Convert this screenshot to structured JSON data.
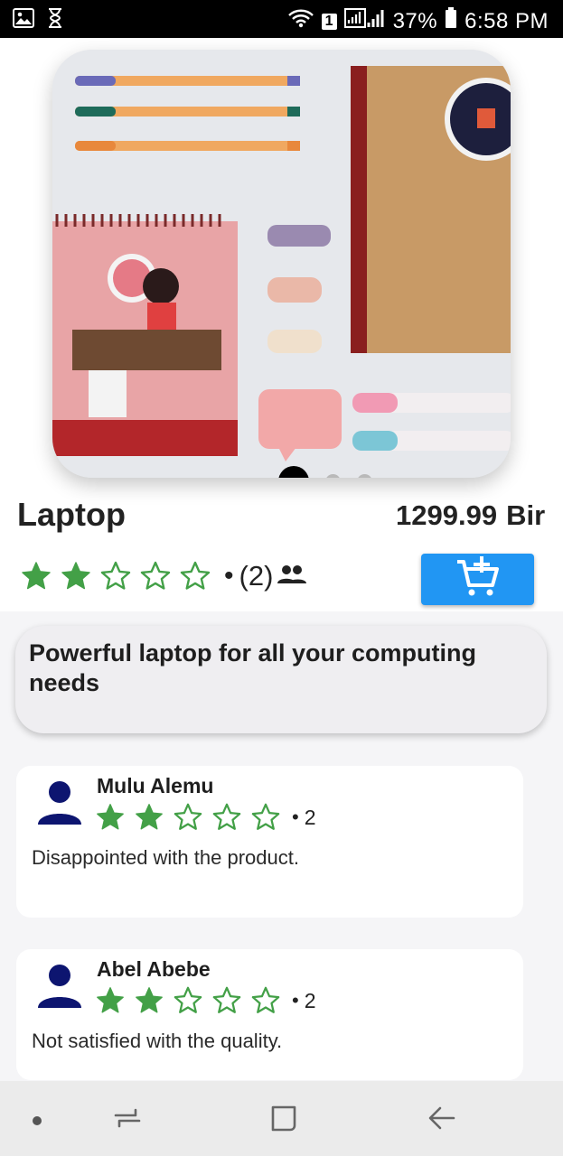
{
  "status_bar": {
    "sim_badge": "1",
    "battery_percent": "37%",
    "time": "6:58 PM",
    "icons": [
      "gallery-icon",
      "hourglass-icon",
      "wifi-icon",
      "signal-icon",
      "battery-icon"
    ]
  },
  "carousel": {
    "image_icon": "stationery-photo",
    "slide_count": 3,
    "active_index": 0
  },
  "product": {
    "name": "Laptop",
    "price": "1299.99",
    "currency": "Birr",
    "rating": 2,
    "rating_max": 5,
    "review_count": "(2)",
    "bullet": "•",
    "description": "Powerful laptop for all your computing needs"
  },
  "reviews": [
    {
      "name": "Mulu Alemu",
      "rating": 2,
      "rating_text": "2",
      "bullet": "•",
      "comment": "Disappointed with the product."
    },
    {
      "name": "Abel Abebe",
      "rating": 2,
      "rating_text": "2",
      "bullet": "•",
      "comment": "Not satisfied with the quality."
    }
  ],
  "colors": {
    "star": "#43a047",
    "cart_button": "#2196f3",
    "avatar": "#0d1570"
  },
  "nav_icons": [
    "nav-dot-icon",
    "recents-icon",
    "home-icon",
    "back-icon"
  ]
}
